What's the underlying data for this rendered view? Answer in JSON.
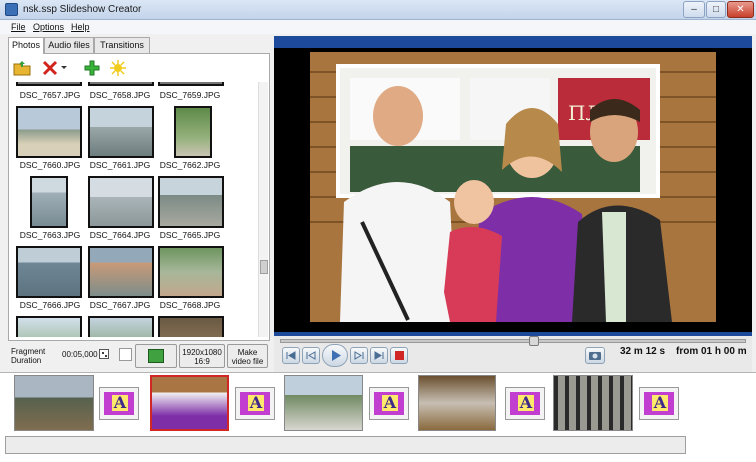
{
  "window": {
    "title": "nsk.ssp  Slideshow Creator",
    "minimize": "–",
    "maximize": "□",
    "close": "✕"
  },
  "menu": [
    "File",
    "Options",
    "Help"
  ],
  "tabs": [
    "Photos",
    "Audio files",
    "Transitions"
  ],
  "photos": {
    "captions": [
      "DSC_7657.JPG",
      "DSC_7658.JPG",
      "DSC_7659.JPG",
      "DSC_7660.JPG",
      "DSC_7661.JPG",
      "DSC_7662.JPG",
      "DSC_7663.JPG",
      "DSC_7664.JPG",
      "DSC_7665.JPG",
      "DSC_7666.JPG",
      "DSC_7667.JPG",
      "DSC_7668.JPG"
    ]
  },
  "bottom_controls": {
    "fragment_label_1": "Fragment",
    "fragment_label_2": "Duration",
    "fragment_duration": "00:05,000",
    "resolution_line1": "1920x1080",
    "resolution_line2": "16:9",
    "make_video_line1": "Make",
    "make_video_line2": "video file"
  },
  "player": {
    "time_total": "32 m 12 s",
    "time_from": "from 01 h 00 m"
  },
  "preview": {
    "sign_text": "ПЛОВ"
  },
  "timeline": {
    "transition_glyph": "A"
  },
  "colors": {
    "accent_blue": "#1e4a9b",
    "transition_purple": "#c23ed0",
    "transition_yellow": "#ffe96a",
    "selected_red": "#d12626"
  },
  "icons": [
    "add-folder-icon",
    "delete-icon",
    "add-icon",
    "magic-icon",
    "fit-icon",
    "first-icon",
    "prev-icon",
    "play-icon",
    "next-icon",
    "last-icon",
    "stop-icon",
    "camera-icon"
  ]
}
